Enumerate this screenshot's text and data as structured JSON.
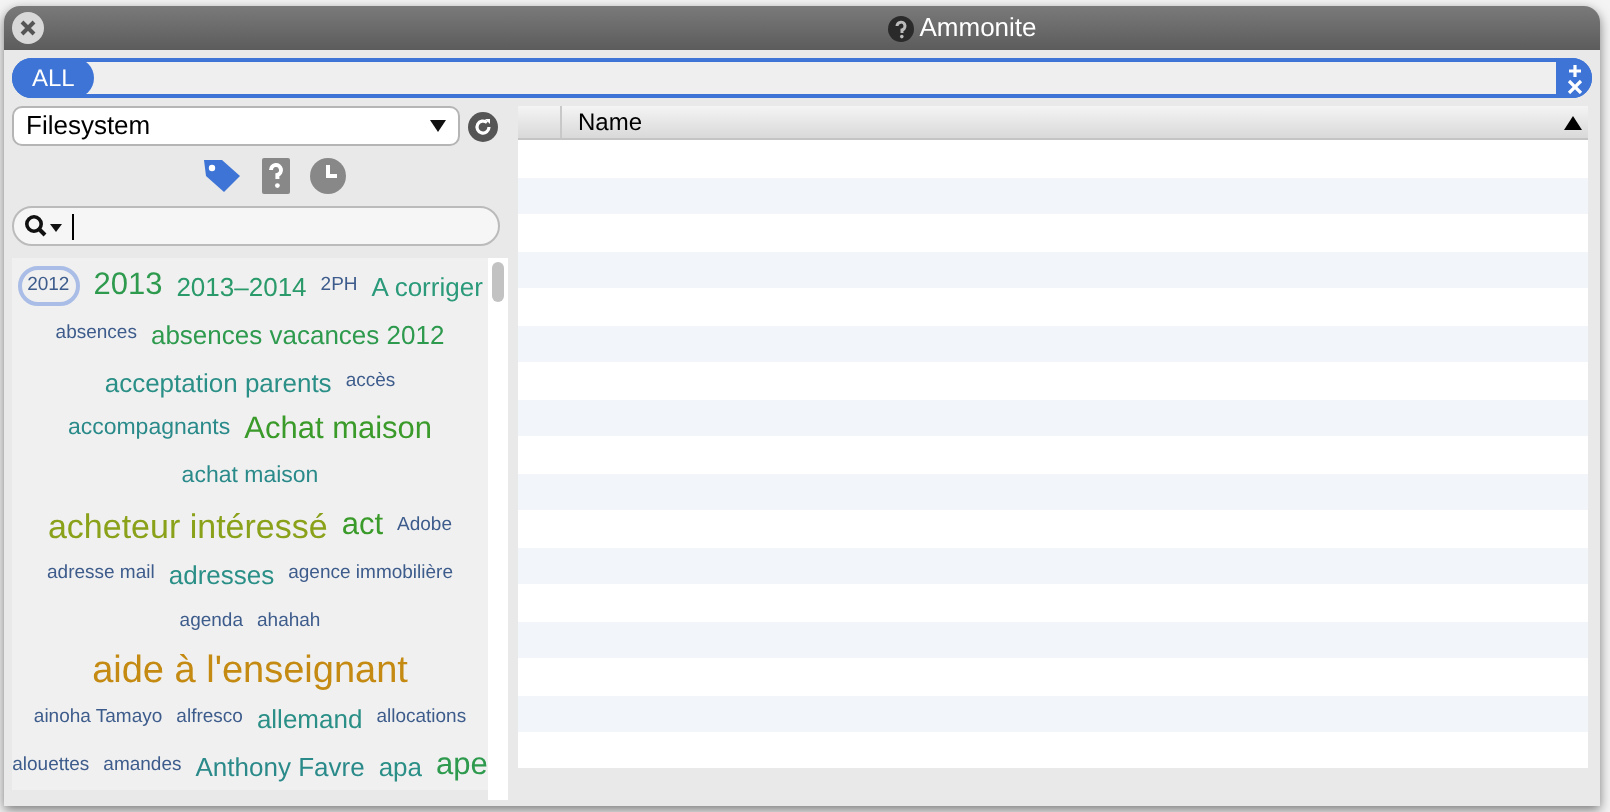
{
  "window": {
    "title": "Ammonite"
  },
  "scope": {
    "label": "ALL"
  },
  "source": {
    "value": "Filesystem"
  },
  "filters": [
    {
      "kind": "tag",
      "selected": true
    },
    {
      "kind": "unknown",
      "selected": false
    },
    {
      "kind": "recent",
      "selected": false
    }
  ],
  "tag_lines": [
    {
      "tags": [
        {
          "text": "2012",
          "kind": "s",
          "color": "#3d5c8c",
          "selected": true
        },
        {
          "text": "2013",
          "kind": "l",
          "color": "#2e9a4e",
          "selected": false
        },
        {
          "text": "2013–2014",
          "kind": "m",
          "color": "#2a9a6a",
          "selected": false
        },
        {
          "text": "2PH",
          "kind": "s",
          "color": "#3d5c8c",
          "selected": false
        },
        {
          "text": "A corriger",
          "kind": "m",
          "color": "#2a9a7a",
          "selected": false
        }
      ]
    },
    {
      "tags": [
        {
          "text": "absences",
          "kind": "s",
          "color": "#3d5c8c",
          "selected": false
        },
        {
          "text": "absences vacances 2012",
          "kind": "m",
          "color": "#2e9a4e",
          "selected": false
        }
      ]
    },
    {
      "tags": [
        {
          "text": "acceptation parents",
          "kind": "m",
          "color": "#2a8f86",
          "selected": false
        },
        {
          "text": "accès",
          "kind": "s",
          "color": "#3d5c8c",
          "selected": false
        }
      ]
    },
    {
      "tags": [
        {
          "text": "accompagnants",
          "kind": "sm",
          "color": "#2a8a8a",
          "selected": false
        },
        {
          "text": "Achat maison",
          "kind": "l",
          "color": "#3a9a2a",
          "selected": false
        }
      ]
    },
    {
      "tags": [
        {
          "text": "achat maison",
          "kind": "sm",
          "color": "#2a8a8a",
          "selected": false
        }
      ]
    },
    {
      "tags": [
        {
          "text": "acheteur intéressé",
          "kind": "xl",
          "color": "#8aa11a",
          "selected": false
        },
        {
          "text": "act",
          "kind": "l",
          "color": "#3a9a2a",
          "selected": false
        },
        {
          "text": "Adobe",
          "kind": "s",
          "color": "#3d5c8c",
          "selected": false
        }
      ]
    },
    {
      "tags": [
        {
          "text": "adresse mail",
          "kind": "s",
          "color": "#3d5c8c",
          "selected": false
        },
        {
          "text": "adresses",
          "kind": "m",
          "color": "#2a8f86",
          "selected": false
        },
        {
          "text": "agence immobilière",
          "kind": "s",
          "color": "#3d5c8c",
          "selected": false
        }
      ]
    },
    {
      "tags": [
        {
          "text": "agenda",
          "kind": "s",
          "color": "#3d5c8c",
          "selected": false
        },
        {
          "text": "ahahah",
          "kind": "s",
          "color": "#3d5c8c",
          "selected": false
        }
      ]
    },
    {
      "tags": [
        {
          "text": "aide à l'enseignant",
          "kind": "xxl",
          "color": "#c48a12",
          "selected": false
        }
      ]
    },
    {
      "tags": [
        {
          "text": "ainoha Tamayo",
          "kind": "s",
          "color": "#3d5c8c",
          "selected": false
        },
        {
          "text": "alfresco",
          "kind": "s",
          "color": "#3d5c8c",
          "selected": false
        },
        {
          "text": "allemand",
          "kind": "m",
          "color": "#2a8f86",
          "selected": false
        },
        {
          "text": "allocations",
          "kind": "s",
          "color": "#3d5c8c",
          "selected": false
        }
      ]
    },
    {
      "tags": [
        {
          "text": "alouettes",
          "kind": "s",
          "color": "#3d5c8c",
          "selected": false
        },
        {
          "text": "amandes",
          "kind": "s",
          "color": "#3d5c8c",
          "selected": false
        },
        {
          "text": "Anthony Favre",
          "kind": "m",
          "color": "#2a8a8a",
          "selected": false
        },
        {
          "text": "apa",
          "kind": "m",
          "color": "#2a8f86",
          "selected": false
        },
        {
          "text": "ape",
          "kind": "l",
          "color": "#2e9a4e",
          "selected": false
        }
      ]
    }
  ],
  "table": {
    "columns": [
      "Name"
    ]
  }
}
